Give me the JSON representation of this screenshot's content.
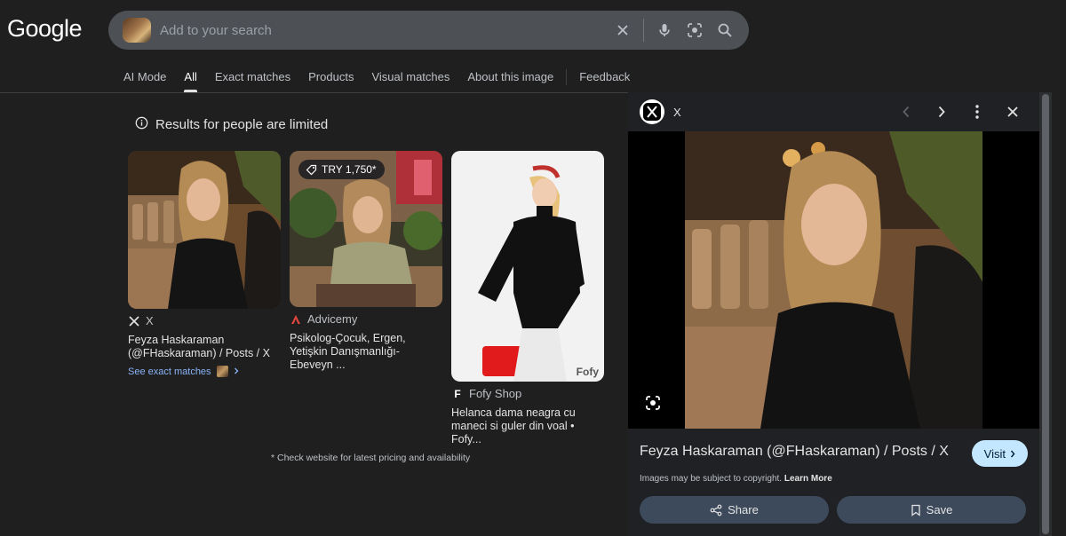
{
  "header": {
    "logo_text": "Google",
    "search": {
      "placeholder": "Add to your search",
      "icons": [
        "close-icon",
        "mic-icon",
        "lens-icon",
        "search-icon"
      ]
    }
  },
  "tabs": [
    {
      "label": "AI Mode",
      "active": false
    },
    {
      "label": "All",
      "active": true
    },
    {
      "label": "Exact matches",
      "active": false
    },
    {
      "label": "Products",
      "active": false
    },
    {
      "label": "Visual matches",
      "active": false
    },
    {
      "label": "About this image",
      "active": false
    },
    {
      "label": "Feedback",
      "active": false
    }
  ],
  "notice": {
    "text": "Results for people are limited"
  },
  "results": [
    {
      "source": "X",
      "title": "Feyza Haskaraman (@FHaskaraman) / Posts / X",
      "see_exact": "See exact matches"
    },
    {
      "source": "Advicemy",
      "title": "Psikolog-Çocuk, Ergen, Yetişkin Danışmanlığı-Ebeveyn ...",
      "badge": "TRY 1,750*"
    },
    {
      "source": "Fofy Shop",
      "title": "Helanca dama neagra cu maneci si guler din voal • Fofy...",
      "watermark": "Fofy"
    }
  ],
  "footnote": "* Check website for latest pricing and availability",
  "panel": {
    "site": "X",
    "title": "Feyza Haskaraman (@FHaskaraman) / Posts / X",
    "visit_label": "Visit",
    "copyright_text": "Images may be subject to copyright.",
    "learn_more": "Learn More",
    "share_label": "Share",
    "save_label": "Save"
  },
  "colors": {
    "background": "#1f1f1f",
    "accent": "#8ab4f8",
    "visit_button": "#c2e7ff"
  }
}
